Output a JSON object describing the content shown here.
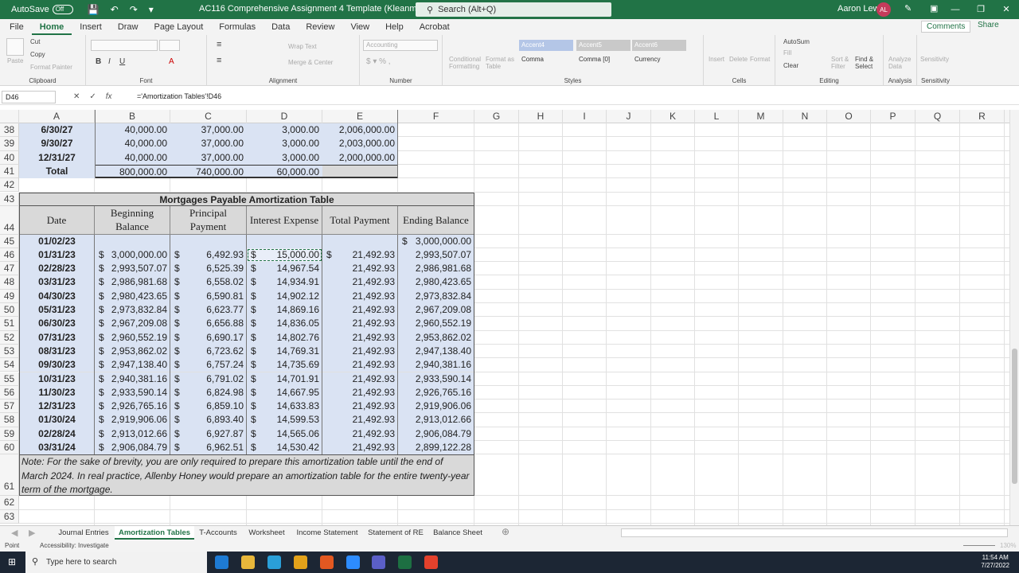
{
  "titlebar": {
    "autosave_label": "AutoSave",
    "autosave_state": "Off",
    "doc_title": "AC116 Comprehensive Assignment 4 Template (Kleanmore)",
    "search_placeholder": "Search (Alt+Q)",
    "user_name": "Aaron Lewis",
    "user_initials": "AL"
  },
  "ribbon_tabs": [
    "File",
    "Home",
    "Insert",
    "Draw",
    "Page Layout",
    "Formulas",
    "Data",
    "Review",
    "View",
    "Help",
    "Acrobat"
  ],
  "ribbon_actions": {
    "comments": "Comments",
    "share": "Share"
  },
  "ribbon": {
    "clipboard": {
      "cut": "Cut",
      "copy": "Copy",
      "format_painter": "Format Painter",
      "paste": "Paste",
      "label": "Clipboard"
    },
    "font": {
      "label": "Font"
    },
    "alignment": {
      "wrap": "Wrap Text",
      "merge": "Merge & Center",
      "label": "Alignment"
    },
    "number": {
      "format": "Accounting",
      "label": "Number"
    },
    "styles": {
      "cond": "Conditional Formatting",
      "table": "Format as Table",
      "accent4": "Accent4",
      "accent5": "Accent5",
      "accent6": "Accent6",
      "comma": "Comma",
      "comma0": "Comma [0]",
      "currency": "Currency",
      "label": "Styles"
    },
    "cells": {
      "insert": "Insert",
      "delete": "Delete",
      "format": "Format",
      "label": "Cells"
    },
    "editing": {
      "autosum": "AutoSum",
      "fill": "Fill",
      "clear": "Clear",
      "sort": "Sort & Filter",
      "find": "Find & Select",
      "label": "Editing"
    },
    "analysis": {
      "analyze": "Analyze Data",
      "label": "Analysis"
    },
    "sensitivity": {
      "label": "Sensitivity",
      "btn": "Sensitivity"
    }
  },
  "formula_bar": {
    "name_box": "D46",
    "formula": "='Amortization Tables'!D46"
  },
  "columns": [
    "A",
    "B",
    "C",
    "D",
    "E",
    "F",
    "G",
    "H",
    "I",
    "J",
    "K",
    "L",
    "M",
    "N",
    "O",
    "P",
    "Q",
    "R"
  ],
  "rows_visible": [
    "38",
    "39",
    "40",
    "41",
    "42",
    "43",
    "44",
    "45",
    "46",
    "47",
    "48",
    "49",
    "50",
    "51",
    "52",
    "53",
    "54",
    "55",
    "56",
    "57",
    "58",
    "59",
    "60",
    "61",
    "62",
    "63"
  ],
  "bond_rows": [
    {
      "date": "6/30/27",
      "b": "40,000.00",
      "c": "37,000.00",
      "d": "3,000.00",
      "e": "2,006,000.00"
    },
    {
      "date": "9/30/27",
      "b": "40,000.00",
      "c": "37,000.00",
      "d": "3,000.00",
      "e": "2,003,000.00"
    },
    {
      "date": "12/31/27",
      "b": "40,000.00",
      "c": "37,000.00",
      "d": "3,000.00",
      "e": "2,000,000.00"
    }
  ],
  "bond_total": {
    "label": "Total",
    "b": "800,000.00",
    "c": "740,000.00",
    "d": "60,000.00"
  },
  "mortgage": {
    "title": "Mortgages Payable  Amortization Table",
    "headers": {
      "date": "Date",
      "beg": "Beginning Balance",
      "principal": "Principal Payment",
      "interest": "Interest Expense",
      "total": "Total Payment",
      "end": "Ending Balance"
    },
    "currency_symbol": "$",
    "first_row": {
      "date": "01/02/23",
      "end": "3,000,000.00"
    },
    "rows": [
      {
        "date": "01/31/23",
        "beg": "3,000,000.00",
        "prin": "6,492.93",
        "int": "15,000.00",
        "tot": "21,492.93",
        "end": "2,993,507.07"
      },
      {
        "date": "02/28/23",
        "beg": "2,993,507.07",
        "prin": "6,525.39",
        "int": "14,967.54",
        "tot": "21,492.93",
        "end": "2,986,981.68"
      },
      {
        "date": "03/31/23",
        "beg": "2,986,981.68",
        "prin": "6,558.02",
        "int": "14,934.91",
        "tot": "21,492.93",
        "end": "2,980,423.65"
      },
      {
        "date": "04/30/23",
        "beg": "2,980,423.65",
        "prin": "6,590.81",
        "int": "14,902.12",
        "tot": "21,492.93",
        "end": "2,973,832.84"
      },
      {
        "date": "05/31/23",
        "beg": "2,973,832.84",
        "prin": "6,623.77",
        "int": "14,869.16",
        "tot": "21,492.93",
        "end": "2,967,209.08"
      },
      {
        "date": "06/30/23",
        "beg": "2,967,209.08",
        "prin": "6,656.88",
        "int": "14,836.05",
        "tot": "21,492.93",
        "end": "2,960,552.19"
      },
      {
        "date": "07/31/23",
        "beg": "2,960,552.19",
        "prin": "6,690.17",
        "int": "14,802.76",
        "tot": "21,492.93",
        "end": "2,953,862.02"
      },
      {
        "date": "08/31/23",
        "beg": "2,953,862.02",
        "prin": "6,723.62",
        "int": "14,769.31",
        "tot": "21,492.93",
        "end": "2,947,138.40"
      },
      {
        "date": "09/30/23",
        "beg": "2,947,138.40",
        "prin": "6,757.24",
        "int": "14,735.69",
        "tot": "21,492.93",
        "end": "2,940,381.16"
      },
      {
        "date": "10/31/23",
        "beg": "2,940,381.16",
        "prin": "6,791.02",
        "int": "14,701.91",
        "tot": "21,492.93",
        "end": "2,933,590.14"
      },
      {
        "date": "11/30/23",
        "beg": "2,933,590.14",
        "prin": "6,824.98",
        "int": "14,667.95",
        "tot": "21,492.93",
        "end": "2,926,765.16"
      },
      {
        "date": "12/31/23",
        "beg": "2,926,765.16",
        "prin": "6,859.10",
        "int": "14,633.83",
        "tot": "21,492.93",
        "end": "2,919,906.06"
      },
      {
        "date": "01/30/24",
        "beg": "2,919,906.06",
        "prin": "6,893.40",
        "int": "14,599.53",
        "tot": "21,492.93",
        "end": "2,913,012.66"
      },
      {
        "date": "02/28/24",
        "beg": "2,913,012.66",
        "prin": "6,927.87",
        "int": "14,565.06",
        "tot": "21,492.93",
        "end": "2,906,084.79"
      },
      {
        "date": "03/31/24",
        "beg": "2,906,084.79",
        "prin": "6,962.51",
        "int": "14,530.42",
        "tot": "21,492.93",
        "end": "2,899,122.28"
      }
    ],
    "note": "Note: For the sake of brevity, you are only required to prepare this amortization table until the end of March 2024.  In real practice, Allenby Honey would prepare an amortization table  for the entire twenty-year term of the mortgage."
  },
  "sheet_tabs": [
    "Journal Entries",
    "Amortization Tables",
    "T-Accounts",
    "Worksheet",
    "Income Statement",
    "Statement of RE",
    "Balance Sheet"
  ],
  "active_sheet": "Amortization Tables",
  "status": {
    "mode": "Point",
    "accessibility": "Accessibility: Investigate",
    "zoom": "130%"
  },
  "taskbar": {
    "search_placeholder": "Type here to search",
    "time": "11:54 AM",
    "date": "7/27/2022"
  },
  "colors": {
    "excel_green": "#217346",
    "table_blue": "#dae3f3",
    "gray_fill": "#d9d9d9"
  }
}
